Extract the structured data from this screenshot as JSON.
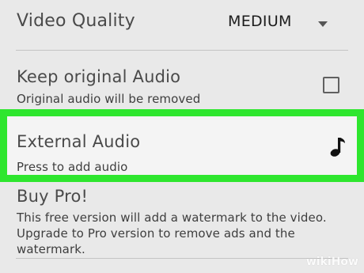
{
  "settings": {
    "video_quality": {
      "label": "Video Quality",
      "selected": "MEDIUM",
      "icon": "dropdown-caret-icon"
    },
    "keep_original_audio": {
      "title": "Keep original Audio",
      "subtitle": "Original audio will be removed",
      "checked": false
    },
    "external_audio": {
      "title": "External Audio",
      "subtitle": "Press to add audio",
      "icon": "music-note-icon",
      "highlight_color": "#2ee62e"
    },
    "buy_pro": {
      "title": "Buy Pro!",
      "description_line1": "This free version will add a watermark to the video.",
      "description_line2": "Upgrade to Pro version to remove ads and the",
      "description_line3": "watermark."
    }
  },
  "watermark": {
    "text": "wikiHow"
  }
}
